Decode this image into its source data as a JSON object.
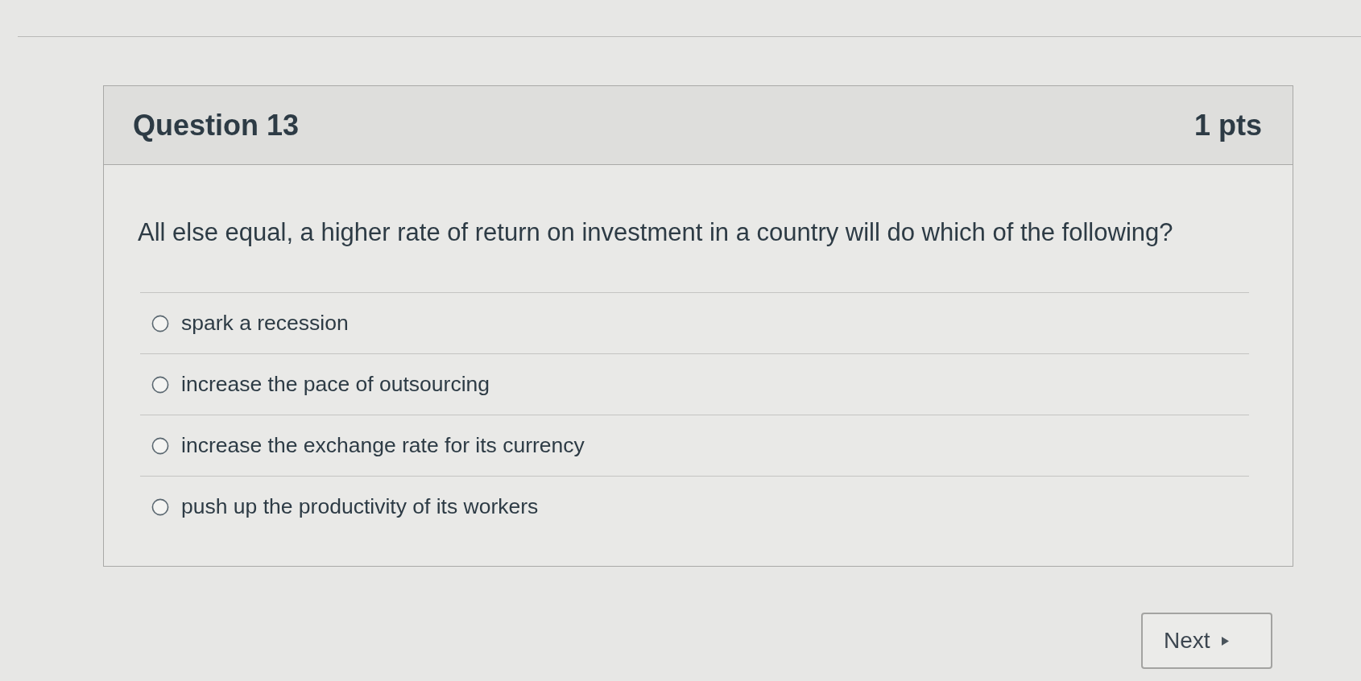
{
  "question": {
    "title": "Question 13",
    "points": "1 pts",
    "text": "All else equal, a higher rate of return on investment in a country will do which of the following?",
    "options": [
      {
        "label": "spark a recession",
        "selected": false
      },
      {
        "label": "increase the pace of outsourcing",
        "selected": false
      },
      {
        "label": "increase the exchange rate for its currency",
        "selected": false
      },
      {
        "label": "push up the productivity of its workers",
        "selected": false
      }
    ]
  },
  "footer": {
    "next_button": {
      "label": "Next"
    }
  }
}
